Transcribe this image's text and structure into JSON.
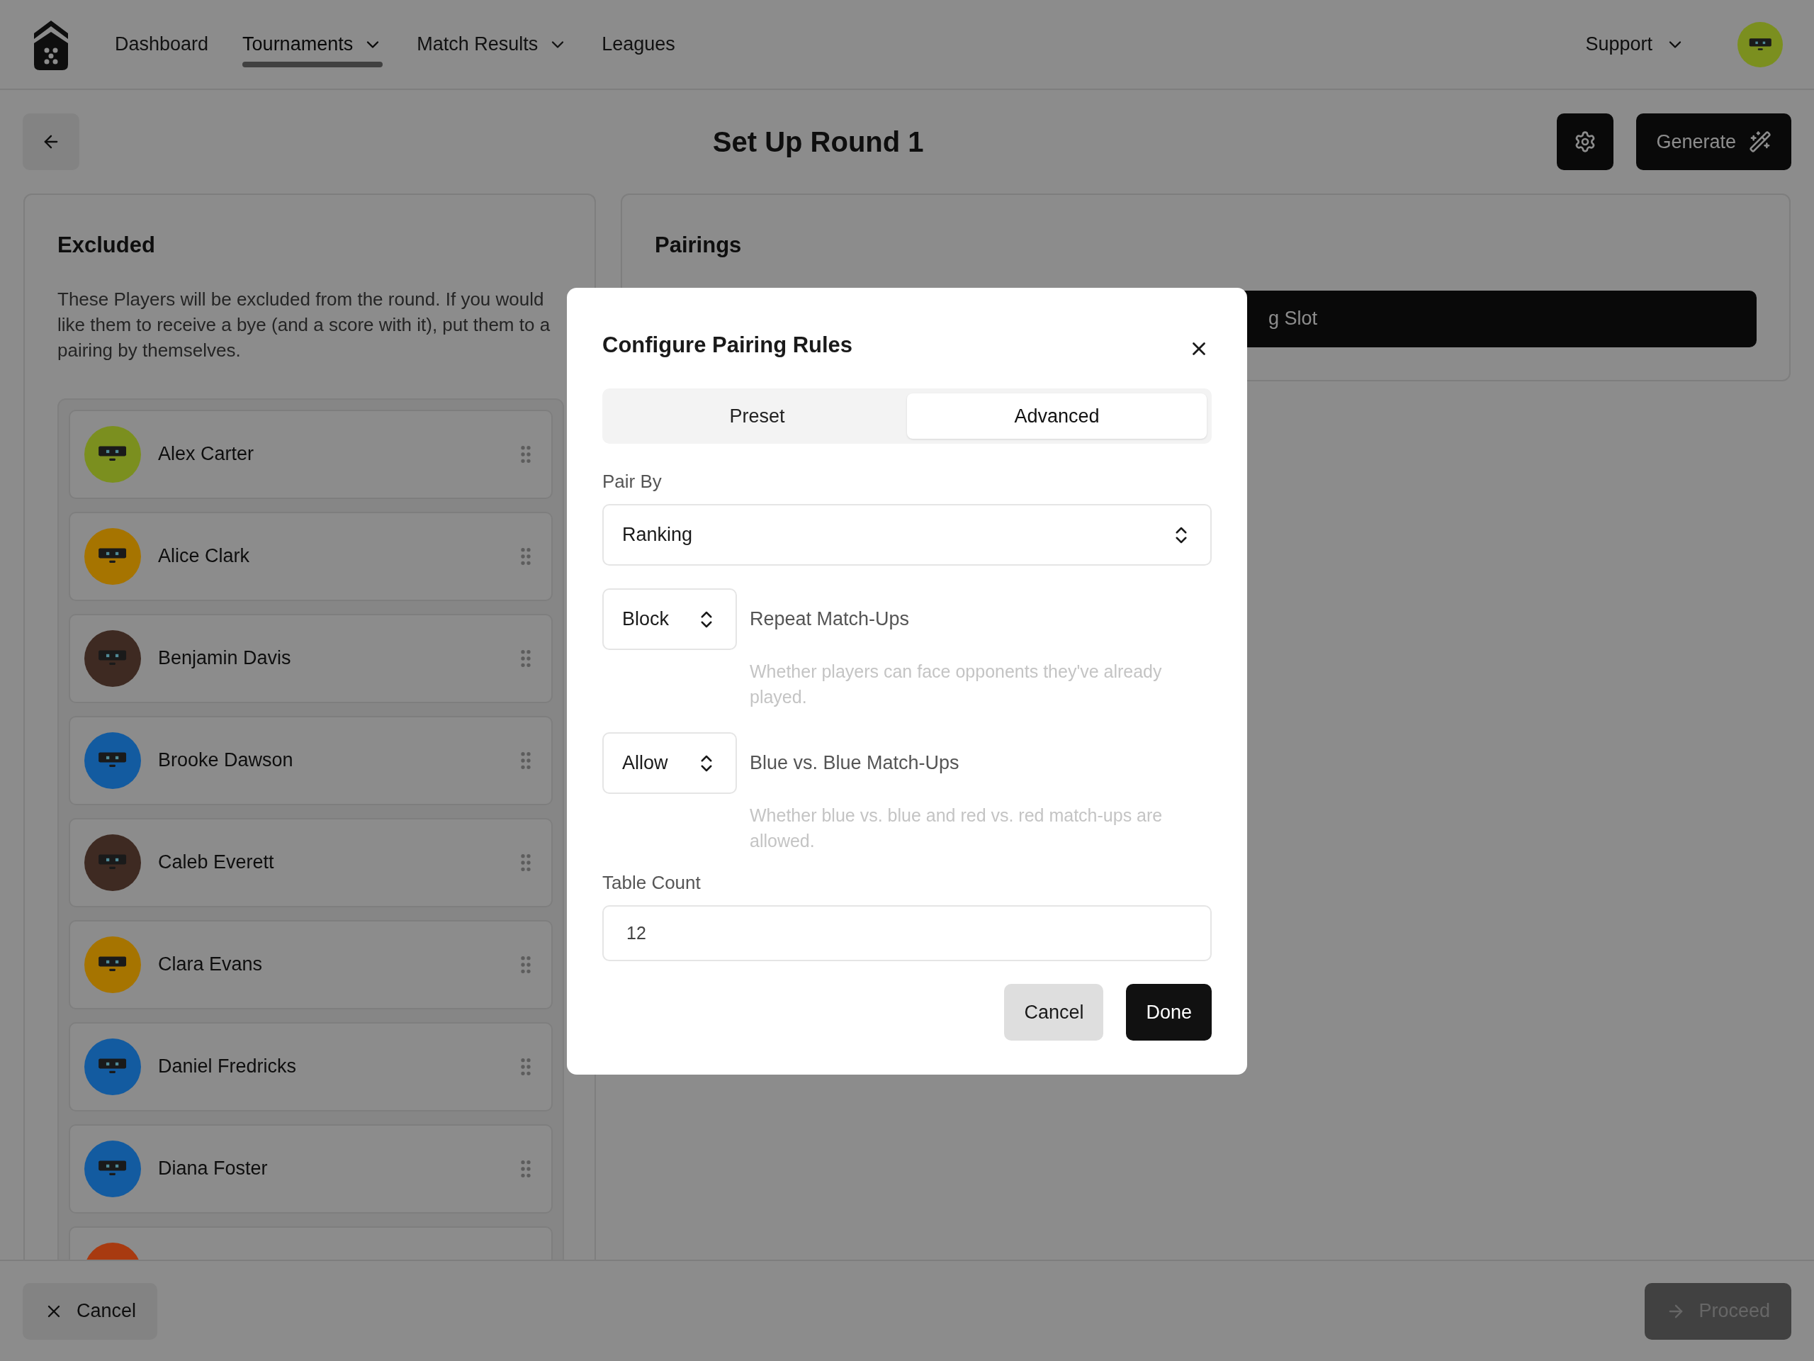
{
  "nav": {
    "items": [
      {
        "label": "Dashboard",
        "selected": false,
        "dropdown": false
      },
      {
        "label": "Tournaments",
        "selected": true,
        "dropdown": true
      },
      {
        "label": "Match Results",
        "selected": false,
        "dropdown": true
      },
      {
        "label": "Leagues",
        "selected": false,
        "dropdown": false
      }
    ],
    "support": "Support",
    "avatar": {
      "color": "#7b8f1f"
    }
  },
  "header": {
    "title": "Set Up Round 1",
    "generate": "Generate"
  },
  "excluded": {
    "title": "Excluded",
    "description": "These Players will be excluded from the round. If you would like them to receive a bye (and a score with it), put them to a pairing by themselves.",
    "players": [
      {
        "name": "Alex Carter",
        "color": "#7b8f1f"
      },
      {
        "name": "Alice Clark",
        "color": "#a67400"
      },
      {
        "name": "Benjamin Davis",
        "color": "#3e2a22"
      },
      {
        "name": "Brooke Dawson",
        "color": "#135ba0"
      },
      {
        "name": "Caleb Everett",
        "color": "#3e2a22"
      },
      {
        "name": "Clara Evans",
        "color": "#a67400"
      },
      {
        "name": "Daniel Fredricks",
        "color": "#135ba0"
      },
      {
        "name": "Diana Foster",
        "color": "#135ba0"
      },
      {
        "color": "#a83a10"
      }
    ]
  },
  "pairings": {
    "title": "Pairings",
    "button": "g Slot"
  },
  "footer": {
    "cancel": "Cancel",
    "proceed": {
      "label": "Proceed",
      "disabled": true
    }
  },
  "dialog": {
    "title": "Configure Pairing Rules",
    "tabs": [
      {
        "label": "Preset",
        "selected": false
      },
      {
        "label": "Advanced",
        "selected": true
      }
    ],
    "pair_by": {
      "label": "Pair By",
      "value": "Ranking"
    },
    "rules": [
      {
        "value": "Block",
        "label": "Repeat Match-Ups",
        "description": "Whether players can face opponents they've already played."
      },
      {
        "value": "Allow",
        "label": "Blue vs. Blue Match-Ups",
        "description": "Whether blue vs. blue and red vs. red match-ups are allowed."
      }
    ],
    "table_count": {
      "label": "Table Count",
      "value": "12"
    },
    "buttons": {
      "cancel": "Cancel",
      "done": "Done"
    }
  }
}
